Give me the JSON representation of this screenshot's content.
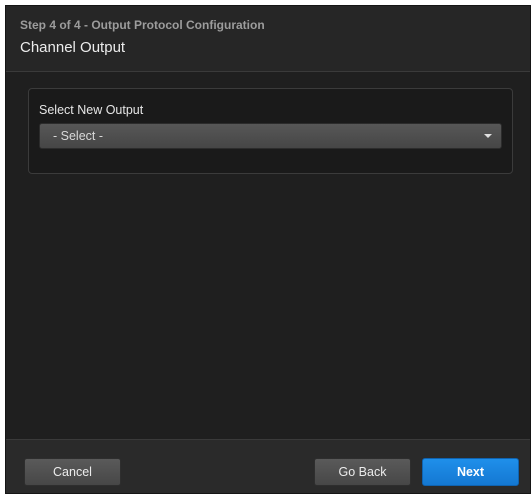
{
  "header": {
    "step": "Step 4 of 4 - Output Protocol Configuration",
    "title": "Channel Output"
  },
  "form": {
    "label": "Select New Output",
    "select_value": "- Select -"
  },
  "footer": {
    "cancel_label": "Cancel",
    "back_label": "Go Back",
    "next_label": "Next"
  },
  "colors": {
    "dialog_bg": "#1f1f1f",
    "primary_button": "#1a86e0"
  }
}
